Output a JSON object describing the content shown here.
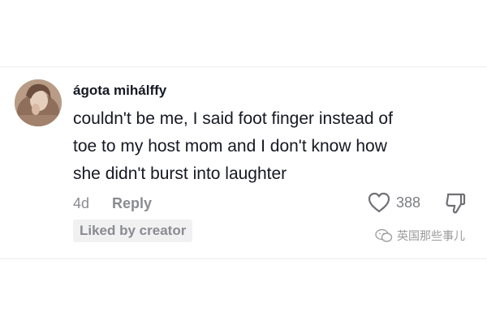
{
  "comment": {
    "username": "ágota mihálffy",
    "text_lines": [
      "couldn't be me, I said foot finger instead of",
      "toe to my host mom and I don't know how",
      "she didn't burst into laughter"
    ],
    "time": "4d",
    "reply_label": "Reply",
    "like_count": "388",
    "liked_by_creator_label": "Liked by creator"
  },
  "watermark": {
    "text": "英国那些事儿"
  },
  "icons": {
    "like": "heart-outline-icon",
    "dislike": "thumbs-down-icon",
    "watermark": "wechat-icon"
  },
  "colors": {
    "text_primary": "#161823",
    "text_secondary": "#8a8b91",
    "badge_bg": "#f1f1f2"
  }
}
